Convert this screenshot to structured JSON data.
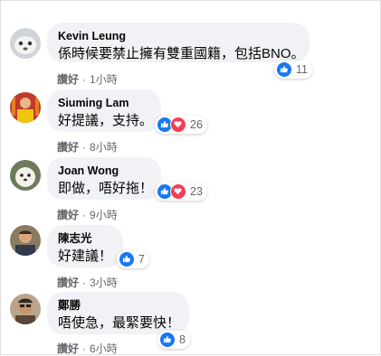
{
  "comments": [
    {
      "author": "Kevin Leung",
      "text": "係時候要禁止擁有雙重國籍，包括BNO。",
      "reaction_count": "11",
      "reactions": [
        "like"
      ],
      "like_label": "讚好",
      "time": "1小時",
      "avatar": "kevin-leung-avatar"
    },
    {
      "author": "Siuming Lam",
      "text": "好提議，支持。",
      "reaction_count": "26",
      "reactions": [
        "like",
        "love"
      ],
      "like_label": "讚好",
      "time": "8小時",
      "avatar": "siuming-lam-avatar"
    },
    {
      "author": "Joan Wong",
      "text": "即做，唔好拖！",
      "reaction_count": "23",
      "reactions": [
        "like",
        "love"
      ],
      "like_label": "讚好",
      "time": "9小時",
      "avatar": "joan-wong-avatar"
    },
    {
      "author": "陳志光",
      "text": "好建議！",
      "reaction_count": "7",
      "reactions": [
        "like"
      ],
      "like_label": "讚好",
      "time": "3小時",
      "avatar": "chan-chi-kwong-avatar"
    },
    {
      "author": "鄭勝",
      "text": "唔使急，最緊要快！",
      "reaction_count": "8",
      "reactions": [
        "like"
      ],
      "like_label": "讚好",
      "time": "6小時",
      "avatar": "cheng-sing-avatar"
    }
  ],
  "separator": "·",
  "colors": {
    "bubble": "#f0f2f5",
    "like": "#1877f2",
    "love": "#f33e58",
    "meta_text": "#65676b"
  }
}
